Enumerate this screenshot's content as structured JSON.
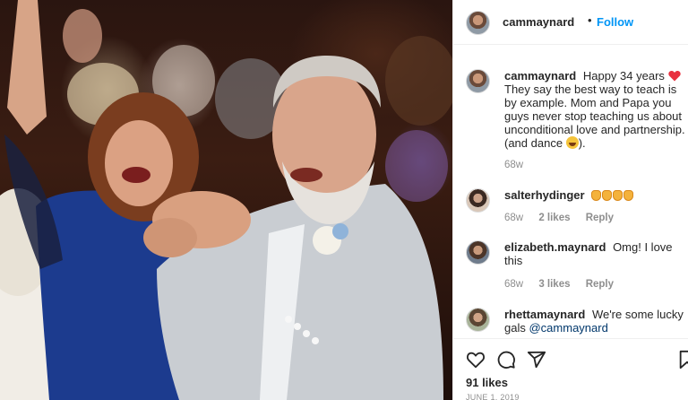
{
  "post": {
    "username": "cammaynard",
    "follow_label": "Follow",
    "separator": "•",
    "likes_text": "91 likes",
    "date_text": "JUNE 1, 2019"
  },
  "caption": {
    "username": "cammaynard",
    "text_before_emoji": "Happy 34 years",
    "heart_emoji_name": "red-heart-emoji",
    "text_after_emoji": "They say the best way to teach is by example. Mom and Papa you guys never stop teaching us about unconditional love and partnership. (and dance",
    "end_emoji_name": "laughing-face-emoji",
    "closing": ").",
    "time": "68w"
  },
  "comments": [
    {
      "username": "salterhydinger",
      "text": "",
      "emoji_name": "clapping-hands-emoji",
      "emoji_count": 4,
      "time": "68w",
      "likes": "2 likes",
      "reply": "Reply"
    },
    {
      "username": "elizabeth.maynard",
      "text": "Omg! I love this",
      "time": "68w",
      "likes": "3 likes",
      "reply": "Reply"
    },
    {
      "username": "rhettamaynard",
      "text": "We're some lucky gals",
      "mention": "@cammaynard"
    }
  ],
  "icons": [
    "heart-icon",
    "comment-icon",
    "share-icon",
    "bookmark-icon"
  ],
  "colors": {
    "accent": "#0095f6",
    "mention": "#00376b",
    "muted": "#8e8e8e",
    "text": "#262626"
  }
}
